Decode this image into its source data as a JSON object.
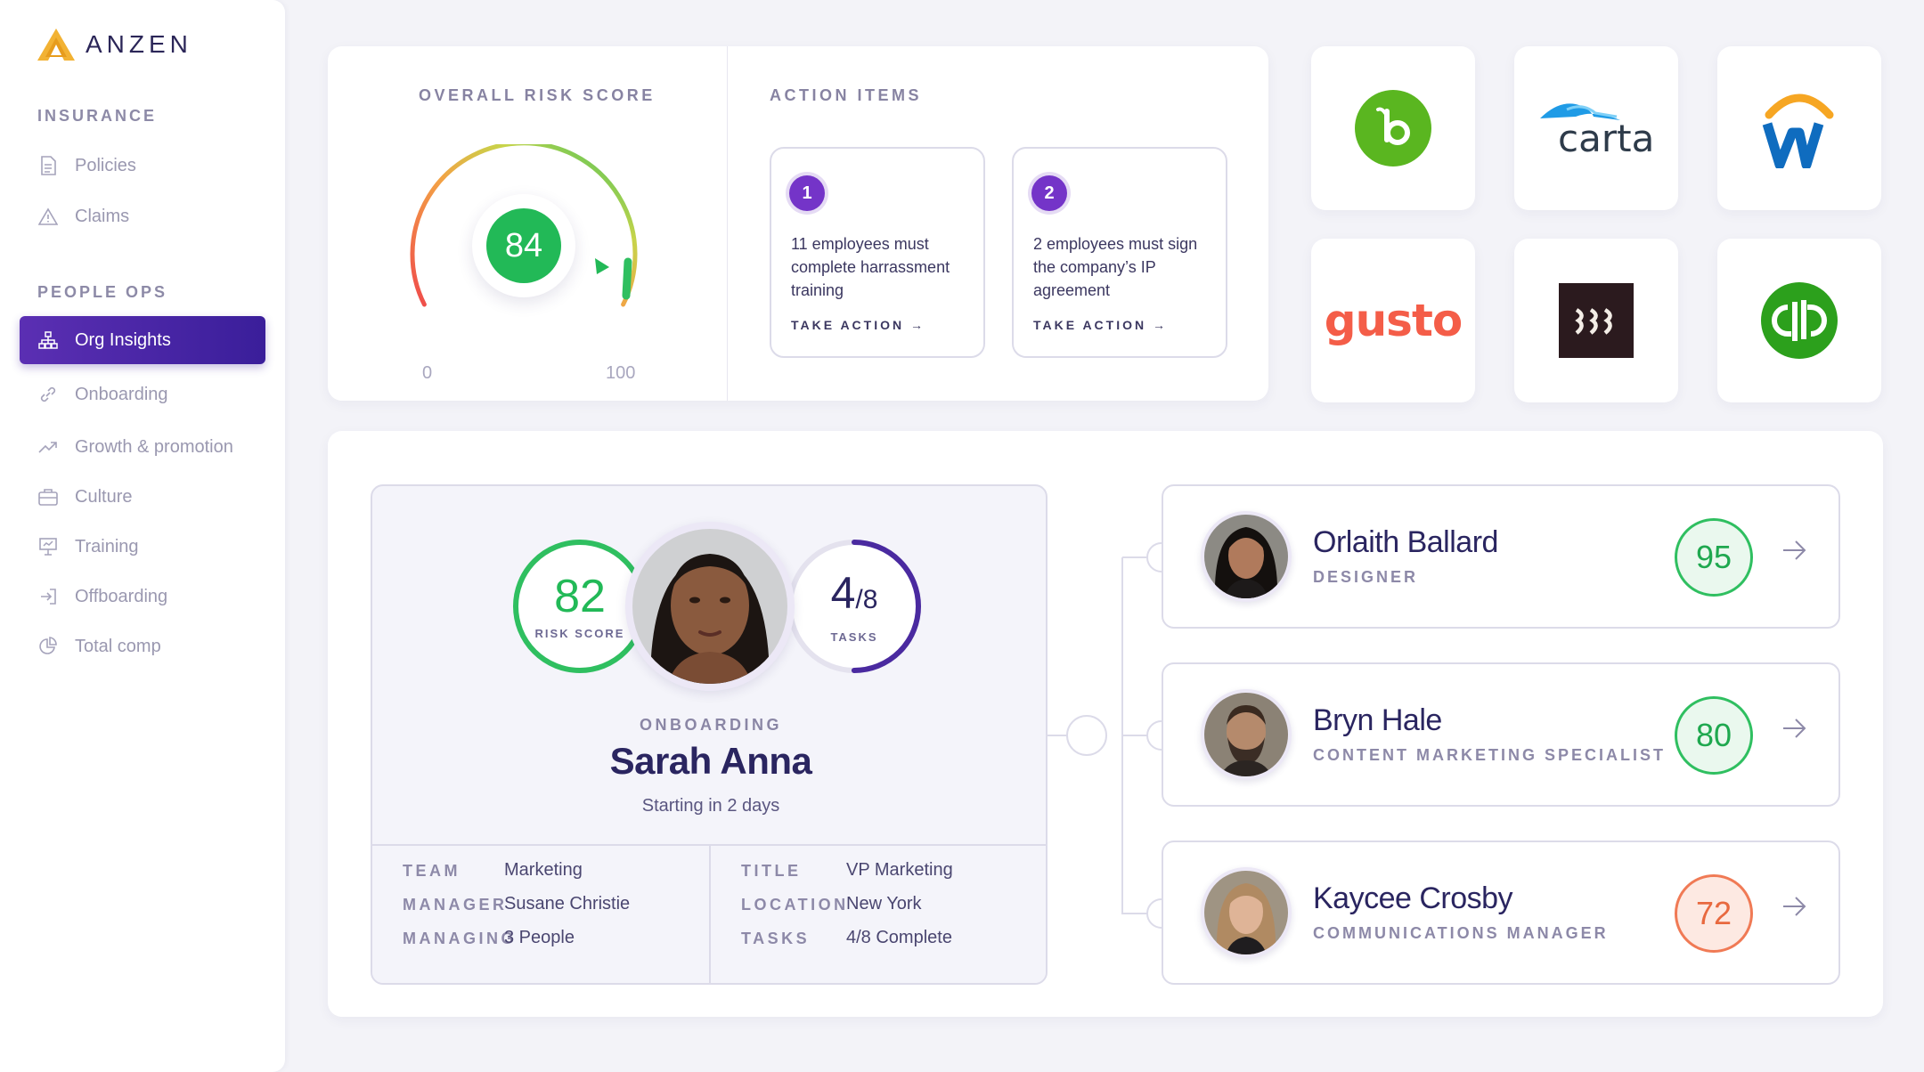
{
  "brand": {
    "name": "ANZEN"
  },
  "sidebar": {
    "sections": [
      {
        "title": "INSURANCE",
        "items": [
          {
            "label": "Policies",
            "icon": "document-icon"
          },
          {
            "label": "Claims",
            "icon": "warning-icon"
          }
        ]
      },
      {
        "title": "PEOPLE OPS",
        "items": [
          {
            "label": "Org Insights",
            "icon": "org-chart-icon",
            "active": true
          },
          {
            "label": "Onboarding",
            "icon": "link-icon"
          },
          {
            "label": "Growth & promotion",
            "icon": "trending-up-icon"
          },
          {
            "label": "Culture",
            "icon": "briefcase-icon"
          },
          {
            "label": "Training",
            "icon": "presentation-icon"
          },
          {
            "label": "Offboarding",
            "icon": "exit-icon"
          },
          {
            "label": "Total comp",
            "icon": "pie-chart-icon"
          }
        ]
      }
    ]
  },
  "risk": {
    "title": "OVERALL RISK SCORE",
    "score": "84",
    "min": "0",
    "max": "100",
    "score_fraction": 0.84
  },
  "actions": {
    "title": "ACTION ITEMS",
    "items": [
      {
        "number": "1",
        "text": "11 employees must complete harrassment training",
        "cta": "TAKE ACTION →"
      },
      {
        "number": "2",
        "text": "2 employees must sign the company’s IP agreement",
        "cta": "TAKE ACTION →"
      }
    ]
  },
  "integrations": [
    {
      "name": "bamboohr-logo",
      "color": "#5ab620"
    },
    {
      "name": "carta-logo",
      "text": "carta",
      "color": "#2a3a4a"
    },
    {
      "name": "workday-logo",
      "color": "#0f6cbf"
    },
    {
      "name": "gusto-logo",
      "text": "gusto",
      "color": "#f45d48"
    },
    {
      "name": "rippling-logo",
      "color": "#2b1a1e"
    },
    {
      "name": "quickbooks-logo",
      "color": "#2ca01c"
    }
  ],
  "profile": {
    "risk_score": "82",
    "risk_label": "RISK SCORE",
    "tasks_done": "4",
    "tasks_total": "/8",
    "tasks_label": "TASKS",
    "tasks_fraction": 0.5,
    "status": "ONBOARDING",
    "name": "Sarah Anna",
    "subtitle": "Starting in 2 days",
    "details_left": [
      {
        "label": "TEAM",
        "value": "Marketing"
      },
      {
        "label": "MANAGER",
        "value": "Susane Christie"
      },
      {
        "label": "MANAGING",
        "value": "3 People"
      }
    ],
    "details_right": [
      {
        "label": "TITLE",
        "value": "VP Marketing"
      },
      {
        "label": "LOCATION",
        "value": "New York"
      },
      {
        "label": "TASKS",
        "value": "4/8 Complete"
      }
    ]
  },
  "reports": [
    {
      "name": "Orlaith Ballard",
      "role": "DESIGNER",
      "score": "95",
      "status": "green"
    },
    {
      "name": "Bryn Hale",
      "role": "CONTENT MARKETING SPECIALIST",
      "score": "80",
      "status": "green"
    },
    {
      "name": "Kaycee Crosby",
      "role": "COMMUNICATIONS MANAGER",
      "score": "72",
      "status": "orange"
    }
  ],
  "colors": {
    "accent": "#4a25a8",
    "good": "#22b957",
    "warn": "#f07a55"
  }
}
